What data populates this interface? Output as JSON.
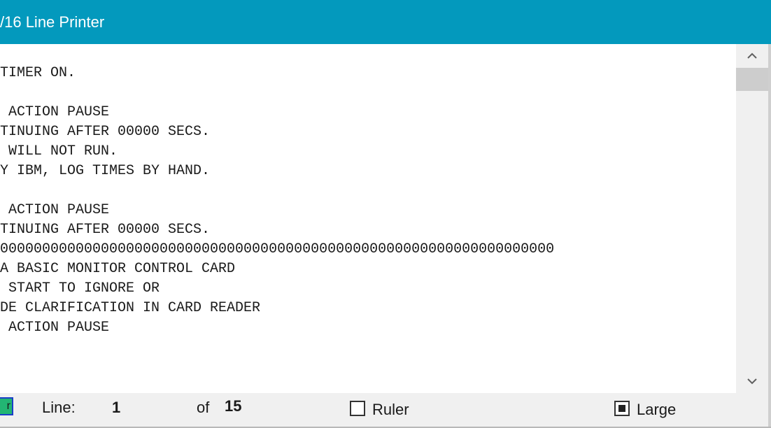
{
  "window": {
    "title": "/16 Line Printer"
  },
  "printout": {
    "lines": [
      "TIMER ON.",
      "",
      " ACTION PAUSE",
      "TINUING AFTER 00000 SECS.",
      " WILL NOT RUN.",
      "Y IBM, LOG TIMES BY HAND.",
      "",
      " ACTION PAUSE",
      "TINUING AFTER 00000 SECS.",
      "000000000000000000000000000000000000000000000000000000000000000000",
      "A BASIC MONITOR CONTROL CARD",
      " START TO IGNORE OR",
      "DE CLARIFICATION IN CARD READER",
      " ACTION PAUSE"
    ]
  },
  "scrollbar": {
    "up_glyph": "^",
    "down_glyph": "v",
    "position_fraction": 0.0
  },
  "statusbar": {
    "button_label": "r",
    "line_label": "Line:",
    "current_line": "1",
    "of_label": "of",
    "total_lines": "15",
    "ruler_label": "Ruler",
    "ruler_checked": false,
    "large_label": "Large",
    "large_checked": true
  },
  "colors": {
    "titlebar": "#0399bd",
    "button_fill": "#22b573",
    "button_border": "#1a3fc7",
    "statusbar": "#f0f0f0"
  },
  "icons": {
    "scroll_up": "chevron-up-icon",
    "scroll_down": "chevron-down-icon"
  }
}
